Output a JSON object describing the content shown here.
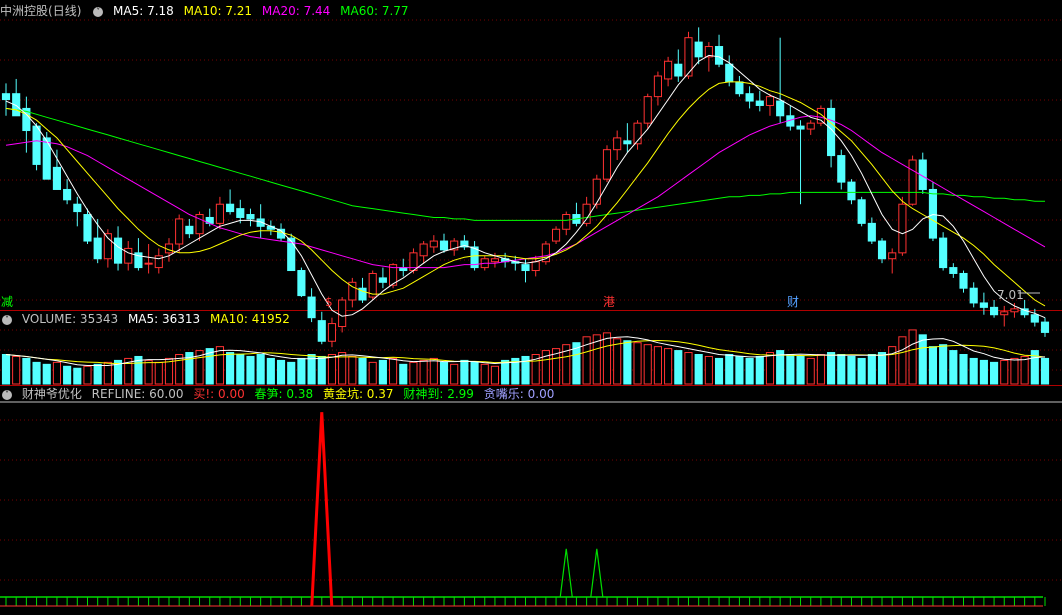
{
  "title": {
    "stock": "中洲控股",
    "period": "(日线)"
  },
  "colors": {
    "up": "#ff3232",
    "down": "#54ffff",
    "ma5": "#ffffff",
    "ma10": "#ffff00",
    "ma20": "#ff00ff",
    "ma60": "#00ff00",
    "grid": "#7a0000",
    "text": "#c0c0c0",
    "vma5": "#ffffff",
    "vma10": "#ffff00",
    "ind_green": "#00dd00",
    "ind_red": "#ff0000",
    "purple": "#a0a0ff"
  },
  "price_panel": {
    "ma5_label": "MA5: 7.18",
    "ma10_label": "MA10: 7.21",
    "ma20_label": "MA20: 7.44",
    "ma60_label": "MA60: 7.77",
    "last_price_label": "7.01",
    "markers": [
      {
        "text": "减",
        "color": "#00ff00"
      },
      {
        "text": "$",
        "color": "#ff3232"
      },
      {
        "text": "港",
        "color": "#ff3232"
      },
      {
        "text": "财",
        "color": "#54a0ff"
      }
    ]
  },
  "volume_panel": {
    "volume_label": "VOLUME: 35343",
    "ma5_label": "MA5: 36313",
    "ma10_label": "MA10: 41952"
  },
  "indicator_panel": {
    "name": "财神爷优化",
    "refline_label": "REFLINE: 60.00",
    "items": [
      {
        "label": "买!: 0.00",
        "color": "#ff3232"
      },
      {
        "label": "春笋: 0.38",
        "color": "#00ff00"
      },
      {
        "label": "黄金坑: 0.37",
        "color": "#ffff00"
      },
      {
        "label": "财神到: 2.99",
        "color": "#00ff00"
      },
      {
        "label": "贪嘴乐: 0.00",
        "color": "#a0a0ff"
      }
    ]
  },
  "chart_data": {
    "type": "candlestick",
    "price_range": [
      6.8,
      8.7
    ],
    "candles": [
      [
        8.2,
        8.27,
        8.05,
        8.16
      ],
      [
        8.2,
        8.3,
        8.05,
        8.05
      ],
      [
        8.1,
        8.18,
        7.8,
        7.95
      ],
      [
        7.98,
        8.0,
        7.68,
        7.72
      ],
      [
        7.9,
        7.94,
        7.66,
        7.62
      ],
      [
        7.7,
        7.82,
        7.55,
        7.55
      ],
      [
        7.55,
        7.62,
        7.45,
        7.48
      ],
      [
        7.45,
        7.5,
        7.3,
        7.4
      ],
      [
        7.38,
        7.42,
        7.18,
        7.2
      ],
      [
        7.22,
        7.35,
        7.05,
        7.08
      ],
      [
        7.08,
        7.28,
        7.02,
        7.25
      ],
      [
        7.22,
        7.3,
        7.0,
        7.05
      ],
      [
        7.05,
        7.2,
        7.0,
        7.15
      ],
      [
        7.12,
        7.22,
        7.0,
        7.02
      ],
      [
        7.05,
        7.18,
        6.98,
        7.05
      ],
      [
        7.02,
        7.15,
        6.98,
        7.1
      ],
      [
        7.12,
        7.22,
        7.06,
        7.18
      ],
      [
        7.18,
        7.38,
        7.12,
        7.35
      ],
      [
        7.3,
        7.35,
        7.22,
        7.25
      ],
      [
        7.25,
        7.4,
        7.2,
        7.38
      ],
      [
        7.36,
        7.42,
        7.3,
        7.32
      ],
      [
        7.32,
        7.5,
        7.28,
        7.45
      ],
      [
        7.45,
        7.55,
        7.38,
        7.4
      ],
      [
        7.42,
        7.48,
        7.32,
        7.36
      ],
      [
        7.38,
        7.42,
        7.3,
        7.35
      ],
      [
        7.35,
        7.45,
        7.22,
        7.3
      ],
      [
        7.3,
        7.34,
        7.24,
        7.28
      ],
      [
        7.28,
        7.32,
        7.2,
        7.22
      ],
      [
        7.22,
        7.25,
        7.0,
        7.0
      ],
      [
        7.0,
        7.02,
        6.82,
        6.83
      ],
      [
        6.82,
        6.88,
        6.65,
        6.68
      ],
      [
        6.66,
        6.72,
        6.5,
        6.52
      ],
      [
        6.52,
        6.68,
        6.48,
        6.64
      ],
      [
        6.62,
        6.82,
        6.58,
        6.8
      ],
      [
        6.8,
        6.95,
        6.75,
        6.92
      ],
      [
        6.88,
        6.95,
        6.78,
        6.8
      ],
      [
        6.82,
        7.0,
        6.8,
        6.98
      ],
      [
        6.95,
        7.02,
        6.88,
        6.92
      ],
      [
        6.9,
        7.05,
        6.88,
        7.04
      ],
      [
        7.02,
        7.08,
        6.96,
        7.0
      ],
      [
        7.0,
        7.15,
        6.98,
        7.12
      ],
      [
        7.1,
        7.2,
        7.05,
        7.18
      ],
      [
        7.16,
        7.24,
        7.12,
        7.2
      ],
      [
        7.2,
        7.25,
        7.12,
        7.14
      ],
      [
        7.14,
        7.22,
        7.1,
        7.2
      ],
      [
        7.2,
        7.24,
        7.14,
        7.16
      ],
      [
        7.16,
        7.2,
        7.0,
        7.02
      ],
      [
        7.02,
        7.1,
        7.0,
        7.08
      ],
      [
        7.06,
        7.12,
        7.02,
        7.08
      ],
      [
        7.08,
        7.12,
        7.02,
        7.06
      ],
      [
        7.06,
        7.1,
        7.0,
        7.05
      ],
      [
        7.04,
        7.08,
        6.92,
        7.0
      ],
      [
        7.0,
        7.1,
        6.96,
        7.06
      ],
      [
        7.06,
        7.2,
        7.04,
        7.18
      ],
      [
        7.2,
        7.3,
        7.18,
        7.28
      ],
      [
        7.28,
        7.4,
        7.24,
        7.38
      ],
      [
        7.38,
        7.46,
        7.3,
        7.32
      ],
      [
        7.32,
        7.5,
        7.3,
        7.45
      ],
      [
        7.45,
        7.65,
        7.42,
        7.62
      ],
      [
        7.62,
        7.85,
        7.6,
        7.82
      ],
      [
        7.82,
        7.95,
        7.75,
        7.9
      ],
      [
        7.88,
        8.0,
        7.8,
        7.86
      ],
      [
        7.86,
        8.02,
        7.82,
        8.0
      ],
      [
        8.0,
        8.2,
        7.96,
        8.18
      ],
      [
        8.18,
        8.35,
        8.12,
        8.32
      ],
      [
        8.3,
        8.45,
        8.25,
        8.42
      ],
      [
        8.4,
        8.5,
        8.28,
        8.32
      ],
      [
        8.32,
        8.62,
        8.3,
        8.58
      ],
      [
        8.55,
        8.65,
        8.4,
        8.45
      ],
      [
        8.45,
        8.55,
        8.35,
        8.52
      ],
      [
        8.52,
        8.6,
        8.38,
        8.4
      ],
      [
        8.4,
        8.46,
        8.25,
        8.28
      ],
      [
        8.28,
        8.32,
        8.18,
        8.2
      ],
      [
        8.2,
        8.25,
        8.1,
        8.15
      ],
      [
        8.15,
        8.22,
        8.08,
        8.12
      ],
      [
        8.12,
        8.2,
        8.05,
        8.18
      ],
      [
        8.15,
        8.58,
        8.0,
        8.05
      ],
      [
        8.05,
        8.12,
        7.95,
        7.98
      ],
      [
        7.98,
        8.02,
        7.45,
        7.96
      ],
      [
        7.96,
        8.02,
        7.92,
        8.0
      ],
      [
        8.0,
        8.12,
        7.98,
        8.1
      ],
      [
        8.1,
        8.16,
        7.7,
        7.78
      ],
      [
        7.78,
        7.82,
        7.55,
        7.6
      ],
      [
        7.6,
        7.62,
        7.45,
        7.48
      ],
      [
        7.48,
        7.5,
        7.3,
        7.32
      ],
      [
        7.32,
        7.36,
        7.18,
        7.2
      ],
      [
        7.2,
        7.22,
        7.05,
        7.08
      ],
      [
        7.08,
        7.15,
        6.98,
        7.12
      ],
      [
        7.12,
        7.5,
        7.1,
        7.45
      ],
      [
        7.45,
        7.78,
        7.44,
        7.75
      ],
      [
        7.75,
        7.8,
        7.52,
        7.55
      ],
      [
        7.55,
        7.6,
        7.2,
        7.22
      ],
      [
        7.22,
        7.26,
        7.0,
        7.02
      ],
      [
        7.02,
        7.05,
        6.95,
        6.98
      ],
      [
        6.98,
        7.0,
        6.85,
        6.88
      ],
      [
        6.88,
        6.92,
        6.75,
        6.78
      ],
      [
        6.78,
        6.85,
        6.7,
        6.75
      ],
      [
        6.75,
        6.8,
        6.68,
        6.7
      ],
      [
        6.7,
        6.76,
        6.62,
        6.72
      ],
      [
        6.72,
        6.78,
        6.68,
        6.74
      ],
      [
        6.74,
        6.8,
        6.68,
        6.7
      ],
      [
        6.7,
        6.74,
        6.62,
        6.65
      ],
      [
        6.65,
        6.68,
        6.55,
        6.58
      ]
    ],
    "ma5": [
      8.15,
      8.12,
      8.06,
      7.98,
      7.88,
      7.76,
      7.64,
      7.52,
      7.41,
      7.31,
      7.22,
      7.16,
      7.12,
      7.1,
      7.09,
      7.08,
      7.1,
      7.14,
      7.18,
      7.22,
      7.26,
      7.3,
      7.32,
      7.34,
      7.34,
      7.33,
      7.3,
      7.27,
      7.2,
      7.1,
      6.97,
      6.84,
      6.73,
      6.69,
      6.7,
      6.74,
      6.8,
      6.86,
      6.91,
      6.95,
      7.0,
      7.05,
      7.1,
      7.13,
      7.15,
      7.17,
      7.15,
      7.12,
      7.1,
      7.08,
      7.06,
      7.05,
      7.06,
      7.08,
      7.12,
      7.18,
      7.26,
      7.35,
      7.46,
      7.58,
      7.7,
      7.8,
      7.88,
      7.96,
      8.06,
      8.16,
      8.26,
      8.34,
      8.42,
      8.46,
      8.45,
      8.41,
      8.35,
      8.29,
      8.23,
      8.19,
      8.16,
      8.12,
      8.08,
      8.04,
      8.02,
      7.96,
      7.88,
      7.78,
      7.66,
      7.52,
      7.38,
      7.28,
      7.25,
      7.28,
      7.35,
      7.38,
      7.37,
      7.3,
      7.2,
      7.08,
      6.96,
      6.86,
      6.8,
      6.76,
      6.73,
      6.71,
      6.68
    ],
    "ma10": [
      8.1,
      8.09,
      8.06,
      8.02,
      7.96,
      7.9,
      7.82,
      7.74,
      7.66,
      7.58,
      7.5,
      7.42,
      7.35,
      7.28,
      7.22,
      7.17,
      7.14,
      7.12,
      7.12,
      7.13,
      7.15,
      7.18,
      7.21,
      7.24,
      7.26,
      7.27,
      7.27,
      7.26,
      7.24,
      7.2,
      7.14,
      7.07,
      7.0,
      6.94,
      6.89,
      6.86,
      6.84,
      6.84,
      6.86,
      6.88,
      6.92,
      6.96,
      7.0,
      7.04,
      7.07,
      7.09,
      7.1,
      7.1,
      7.1,
      7.1,
      7.09,
      7.08,
      7.08,
      7.09,
      7.11,
      7.14,
      7.18,
      7.24,
      7.3,
      7.38,
      7.46,
      7.55,
      7.64,
      7.73,
      7.83,
      7.93,
      8.02,
      8.1,
      8.17,
      8.23,
      8.27,
      8.28,
      8.28,
      8.27,
      8.25,
      8.22,
      8.2,
      8.17,
      8.14,
      8.1,
      8.06,
      8.0,
      7.94,
      7.88,
      7.8,
      7.72,
      7.63,
      7.54,
      7.47,
      7.42,
      7.38,
      7.34,
      7.3,
      7.26,
      7.22,
      7.17,
      7.11,
      7.04,
      6.98,
      6.92,
      6.86,
      6.8,
      6.76
    ],
    "ma20": [
      7.85,
      7.86,
      7.87,
      7.88,
      7.87,
      7.86,
      7.84,
      7.81,
      7.78,
      7.74,
      7.7,
      7.66,
      7.62,
      7.58,
      7.54,
      7.5,
      7.46,
      7.42,
      7.38,
      7.35,
      7.32,
      7.29,
      7.27,
      7.25,
      7.23,
      7.22,
      7.21,
      7.2,
      7.19,
      7.18,
      7.16,
      7.14,
      7.12,
      7.1,
      7.08,
      7.06,
      7.04,
      7.03,
      7.02,
      7.02,
      7.02,
      7.02,
      7.02,
      7.02,
      7.03,
      7.04,
      7.04,
      7.05,
      7.05,
      7.06,
      7.07,
      7.08,
      7.09,
      7.1,
      7.12,
      7.15,
      7.18,
      7.22,
      7.26,
      7.3,
      7.34,
      7.38,
      7.42,
      7.46,
      7.5,
      7.55,
      7.6,
      7.65,
      7.7,
      7.75,
      7.8,
      7.84,
      7.88,
      7.92,
      7.95,
      7.98,
      8.0,
      8.02,
      8.04,
      8.05,
      8.04,
      8.02,
      7.99,
      7.95,
      7.9,
      7.85,
      7.8,
      7.76,
      7.72,
      7.68,
      7.64,
      7.6,
      7.56,
      7.52,
      7.48,
      7.44,
      7.4,
      7.36,
      7.32,
      7.28,
      7.24,
      7.2,
      7.16
    ],
    "ma60": [
      8.1,
      8.09,
      8.08,
      8.06,
      8.04,
      8.02,
      8.0,
      7.98,
      7.96,
      7.94,
      7.92,
      7.9,
      7.88,
      7.86,
      7.84,
      7.82,
      7.8,
      7.78,
      7.76,
      7.74,
      7.72,
      7.7,
      7.68,
      7.66,
      7.64,
      7.62,
      7.6,
      7.58,
      7.56,
      7.54,
      7.52,
      7.5,
      7.48,
      7.46,
      7.44,
      7.43,
      7.42,
      7.41,
      7.4,
      7.39,
      7.38,
      7.37,
      7.36,
      7.36,
      7.35,
      7.35,
      7.34,
      7.34,
      7.34,
      7.34,
      7.34,
      7.34,
      7.34,
      7.34,
      7.34,
      7.34,
      7.35,
      7.36,
      7.37,
      7.38,
      7.39,
      7.4,
      7.41,
      7.42,
      7.43,
      7.44,
      7.45,
      7.46,
      7.47,
      7.48,
      7.49,
      7.5,
      7.5,
      7.51,
      7.51,
      7.52,
      7.52,
      7.53,
      7.53,
      7.53,
      7.53,
      7.53,
      7.53,
      7.53,
      7.53,
      7.53,
      7.53,
      7.53,
      7.53,
      7.53,
      7.53,
      7.52,
      7.52,
      7.51,
      7.51,
      7.5,
      7.5,
      7.49,
      7.49,
      7.48,
      7.48,
      7.47,
      7.47
    ],
    "volumes": [
      30,
      28,
      26,
      22,
      20,
      22,
      18,
      16,
      18,
      20,
      22,
      24,
      26,
      28,
      24,
      22,
      26,
      30,
      32,
      34,
      36,
      38,
      32,
      30,
      28,
      30,
      26,
      24,
      22,
      26,
      30,
      28,
      30,
      32,
      28,
      26,
      22,
      24,
      26,
      20,
      22,
      24,
      26,
      22,
      20,
      24,
      22,
      20,
      18,
      24,
      26,
      28,
      30,
      34,
      36,
      40,
      42,
      48,
      50,
      52,
      46,
      44,
      42,
      40,
      38,
      36,
      34,
      32,
      30,
      28,
      26,
      30,
      28,
      26,
      28,
      32,
      34,
      30,
      28,
      26,
      30,
      32,
      30,
      28,
      26,
      30,
      32,
      38,
      48,
      55,
      50,
      38,
      40,
      34,
      30,
      26,
      24,
      22,
      24,
      26,
      28,
      34,
      26
    ],
    "volume_range": [
      0,
      60
    ],
    "volume_up": [
      false,
      true,
      false,
      false,
      false,
      true,
      false,
      false,
      true,
      false,
      true,
      false,
      true,
      false,
      true,
      true,
      true,
      true,
      false,
      true,
      false,
      true,
      false,
      false,
      false,
      false,
      false,
      false,
      false,
      false,
      false,
      false,
      true,
      true,
      true,
      false,
      true,
      false,
      true,
      false,
      true,
      true,
      true,
      false,
      true,
      false,
      false,
      true,
      true,
      false,
      false,
      false,
      true,
      true,
      true,
      true,
      false,
      true,
      true,
      true,
      true,
      false,
      true,
      true,
      true,
      true,
      false,
      true,
      false,
      true,
      false,
      false,
      false,
      false,
      false,
      true,
      false,
      false,
      false,
      true,
      true,
      false,
      false,
      false,
      false,
      false,
      false,
      true,
      true,
      true,
      false,
      false,
      false,
      false,
      false,
      false,
      false,
      false,
      true,
      true,
      true,
      false,
      false
    ],
    "indicator": {
      "range": [
        0,
        100
      ],
      "red_spikes": [
        {
          "index": 31,
          "value": 95
        }
      ],
      "green_spikes": [
        {
          "index": 55,
          "value": 28
        },
        {
          "index": 58,
          "value": 28
        }
      ]
    }
  }
}
